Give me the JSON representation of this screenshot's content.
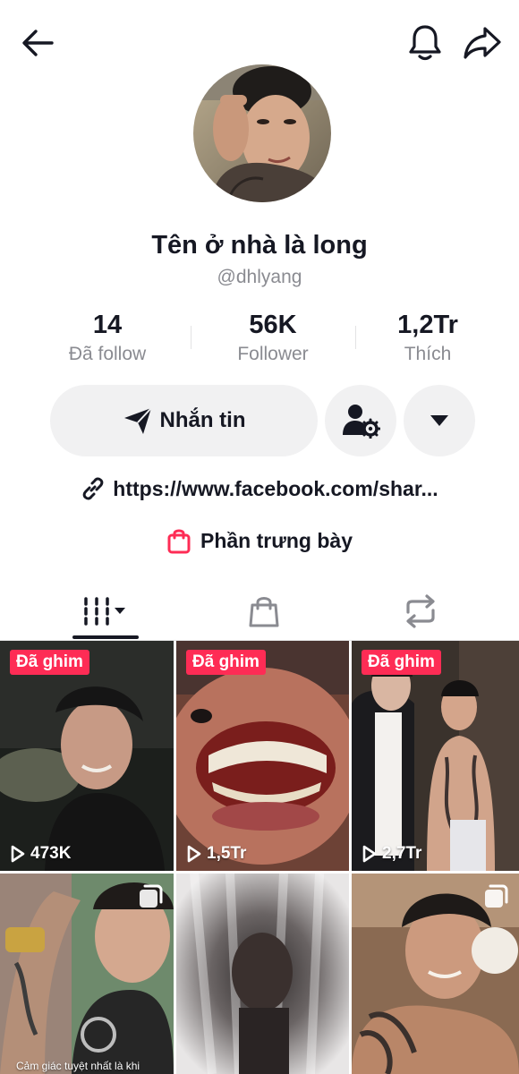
{
  "profile": {
    "name": "Tên ở nhà là long",
    "handle": "@dhlyang"
  },
  "stats": [
    {
      "value": "14",
      "label": "Đã follow"
    },
    {
      "value": "56K",
      "label": "Follower"
    },
    {
      "value": "1,2Tr",
      "label": "Thích"
    }
  ],
  "actions": {
    "message_label": "Nhắn tin"
  },
  "bio": {
    "link": "https://www.facebook.com/shar..."
  },
  "shop": {
    "label": "Phần trưng bày"
  },
  "icons": {
    "back": "back-arrow-icon",
    "notifications": "bell-icon",
    "share": "share-icon",
    "message": "send-icon",
    "add_friend": "user-settings-icon",
    "more": "dropdown-icon",
    "link": "link-icon",
    "shop": "shopping-bag-icon",
    "videos_tab": "grid-icon",
    "shop_tab": "shopping-bag-icon",
    "reposts_tab": "repost-icon"
  },
  "colors": {
    "accent": "#fe2c55",
    "text": "#161823",
    "muted": "#8a8b91",
    "button_bg": "#f1f1f2"
  },
  "videos": [
    {
      "pinned_label": "Đã ghim",
      "views": "473K"
    },
    {
      "pinned_label": "Đã ghim",
      "views": "1,5Tr"
    },
    {
      "pinned_label": "Đã ghim",
      "views": "2,7Tr"
    },
    {
      "caption": "Cảm giác tuyệt nhất là khi"
    },
    {},
    {}
  ]
}
